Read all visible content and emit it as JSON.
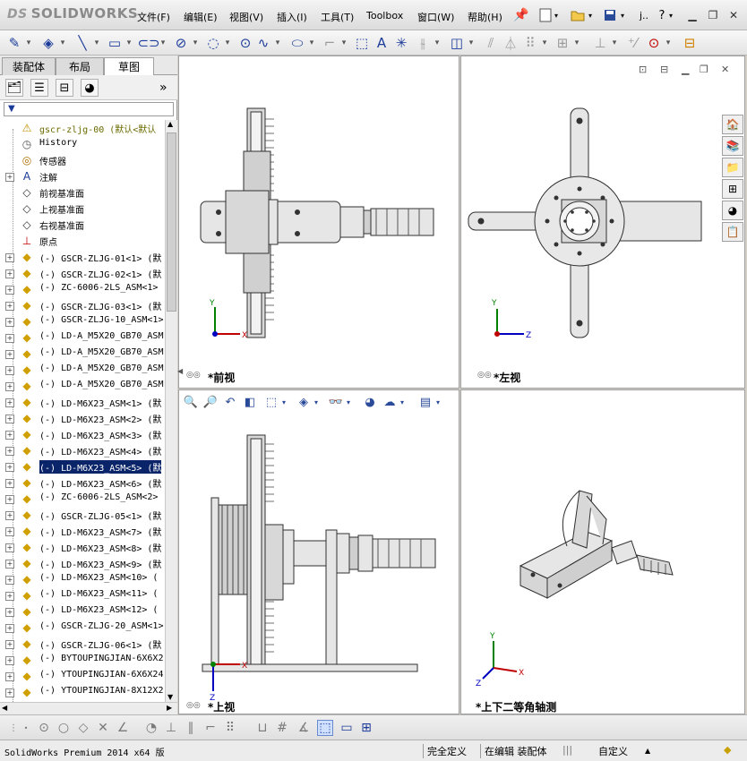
{
  "app": {
    "logo_prefix": "DS",
    "logo_text": "SOLIDWORKS"
  },
  "menu": {
    "items": [
      "文件(F)",
      "编辑(E)",
      "视图(V)",
      "插入(I)",
      "工具(T)",
      "Toolbox",
      "窗口(W)",
      "帮助(H)"
    ],
    "help_label": "?",
    "overflow_label": "j.."
  },
  "panel": {
    "tabs": [
      "装配体",
      "布局",
      "草图"
    ],
    "active_tab": "草图",
    "filter_symbol": "▼",
    "tree": [
      {
        "label": "gscr-zljg-00  (默认<默认",
        "icon": "assembly-warning",
        "expand": "",
        "root": true
      },
      {
        "label": "History",
        "icon": "history",
        "expand": ""
      },
      {
        "label": "传感器",
        "icon": "sensor",
        "expand": ""
      },
      {
        "label": "注解",
        "icon": "annotation",
        "expand": "+"
      },
      {
        "label": "前视基准面",
        "icon": "plane",
        "expand": ""
      },
      {
        "label": "上视基准面",
        "icon": "plane",
        "expand": ""
      },
      {
        "label": "右视基准面",
        "icon": "plane",
        "expand": ""
      },
      {
        "label": "原点",
        "icon": "origin",
        "expand": ""
      },
      {
        "label": "(-) GSCR-ZLJG-01<1> (默",
        "icon": "part",
        "expand": "+"
      },
      {
        "label": "(-) GSCR-ZLJG-02<1> (默",
        "icon": "part",
        "expand": "+"
      },
      {
        "label": "(-) ZC-6006-2LS_ASM<1>",
        "icon": "part",
        "expand": "+"
      },
      {
        "label": "(-) GSCR-ZLJG-03<1> (默",
        "icon": "part",
        "expand": "+"
      },
      {
        "label": "(-) GSCR-ZLJG-10_ASM<1>",
        "icon": "part",
        "expand": "+"
      },
      {
        "label": "(-) LD-A_M5X20_GB70_ASM",
        "icon": "part",
        "expand": "+"
      },
      {
        "label": "(-) LD-A_M5X20_GB70_ASM",
        "icon": "part",
        "expand": "+"
      },
      {
        "label": "(-) LD-A_M5X20_GB70_ASM",
        "icon": "part",
        "expand": "+"
      },
      {
        "label": "(-) LD-A_M5X20_GB70_ASM",
        "icon": "part",
        "expand": "+"
      },
      {
        "label": "(-) LD-M6X23_ASM<1> (默",
        "icon": "part",
        "expand": "+"
      },
      {
        "label": "(-) LD-M6X23_ASM<2> (默",
        "icon": "part",
        "expand": "+"
      },
      {
        "label": "(-) LD-M6X23_ASM<3> (默",
        "icon": "part",
        "expand": "+"
      },
      {
        "label": "(-) LD-M6X23_ASM<4> (默",
        "icon": "part",
        "expand": "+"
      },
      {
        "label": "(-) LD-M6X23_ASM<5> (默",
        "icon": "part",
        "expand": "+",
        "selected": true
      },
      {
        "label": "(-) LD-M6X23_ASM<6> (默",
        "icon": "part",
        "expand": "+"
      },
      {
        "label": "(-) ZC-6006-2LS_ASM<2>",
        "icon": "part",
        "expand": "+"
      },
      {
        "label": "(-) GSCR-ZLJG-05<1> (默",
        "icon": "part",
        "expand": "+"
      },
      {
        "label": "(-) LD-M6X23_ASM<7> (默",
        "icon": "part",
        "expand": "+"
      },
      {
        "label": "(-) LD-M6X23_ASM<8> (默",
        "icon": "part",
        "expand": "+"
      },
      {
        "label": "(-) LD-M6X23_ASM<9> (默",
        "icon": "part",
        "expand": "+"
      },
      {
        "label": "(-) LD-M6X23_ASM<10> (",
        "icon": "part",
        "expand": "+"
      },
      {
        "label": "(-) LD-M6X23_ASM<11> (",
        "icon": "part",
        "expand": "+"
      },
      {
        "label": "(-) LD-M6X23_ASM<12> (",
        "icon": "part",
        "expand": "+"
      },
      {
        "label": "(-) GSCR-ZLJG-20_ASM<1>",
        "icon": "part",
        "expand": "+"
      },
      {
        "label": "(-) GSCR-ZLJG-06<1> (默",
        "icon": "part",
        "expand": "+"
      },
      {
        "label": "(-) BYTOUPINGJIAN-6X6X2",
        "icon": "part",
        "expand": "+"
      },
      {
        "label": "(-) YTOUPINGJIAN-6X6X24",
        "icon": "part",
        "expand": "+"
      },
      {
        "label": "(-) YTOUPINGJIAN-8X12X2",
        "icon": "part",
        "expand": "+"
      }
    ]
  },
  "viewports": {
    "front": {
      "label": "*前视"
    },
    "left": {
      "label": "*左视"
    },
    "top": {
      "label": "*上视"
    },
    "iso": {
      "label": "*上下二等角轴测"
    },
    "axis": {
      "x": "X",
      "y": "Y",
      "z": "Z"
    }
  },
  "status": {
    "product": "SolidWorks Premium 2014 x64 版",
    "definition": "完全定义",
    "editing": "在编辑 装配体",
    "units": "自定义",
    "units_arrow": "▲"
  },
  "colors": {
    "selection": "#0a246a",
    "axis_x": "#c00000",
    "axis_y": "#008000",
    "axis_z": "#0000c0",
    "model_fill": "#e6e6e6",
    "model_stroke": "#303030"
  }
}
